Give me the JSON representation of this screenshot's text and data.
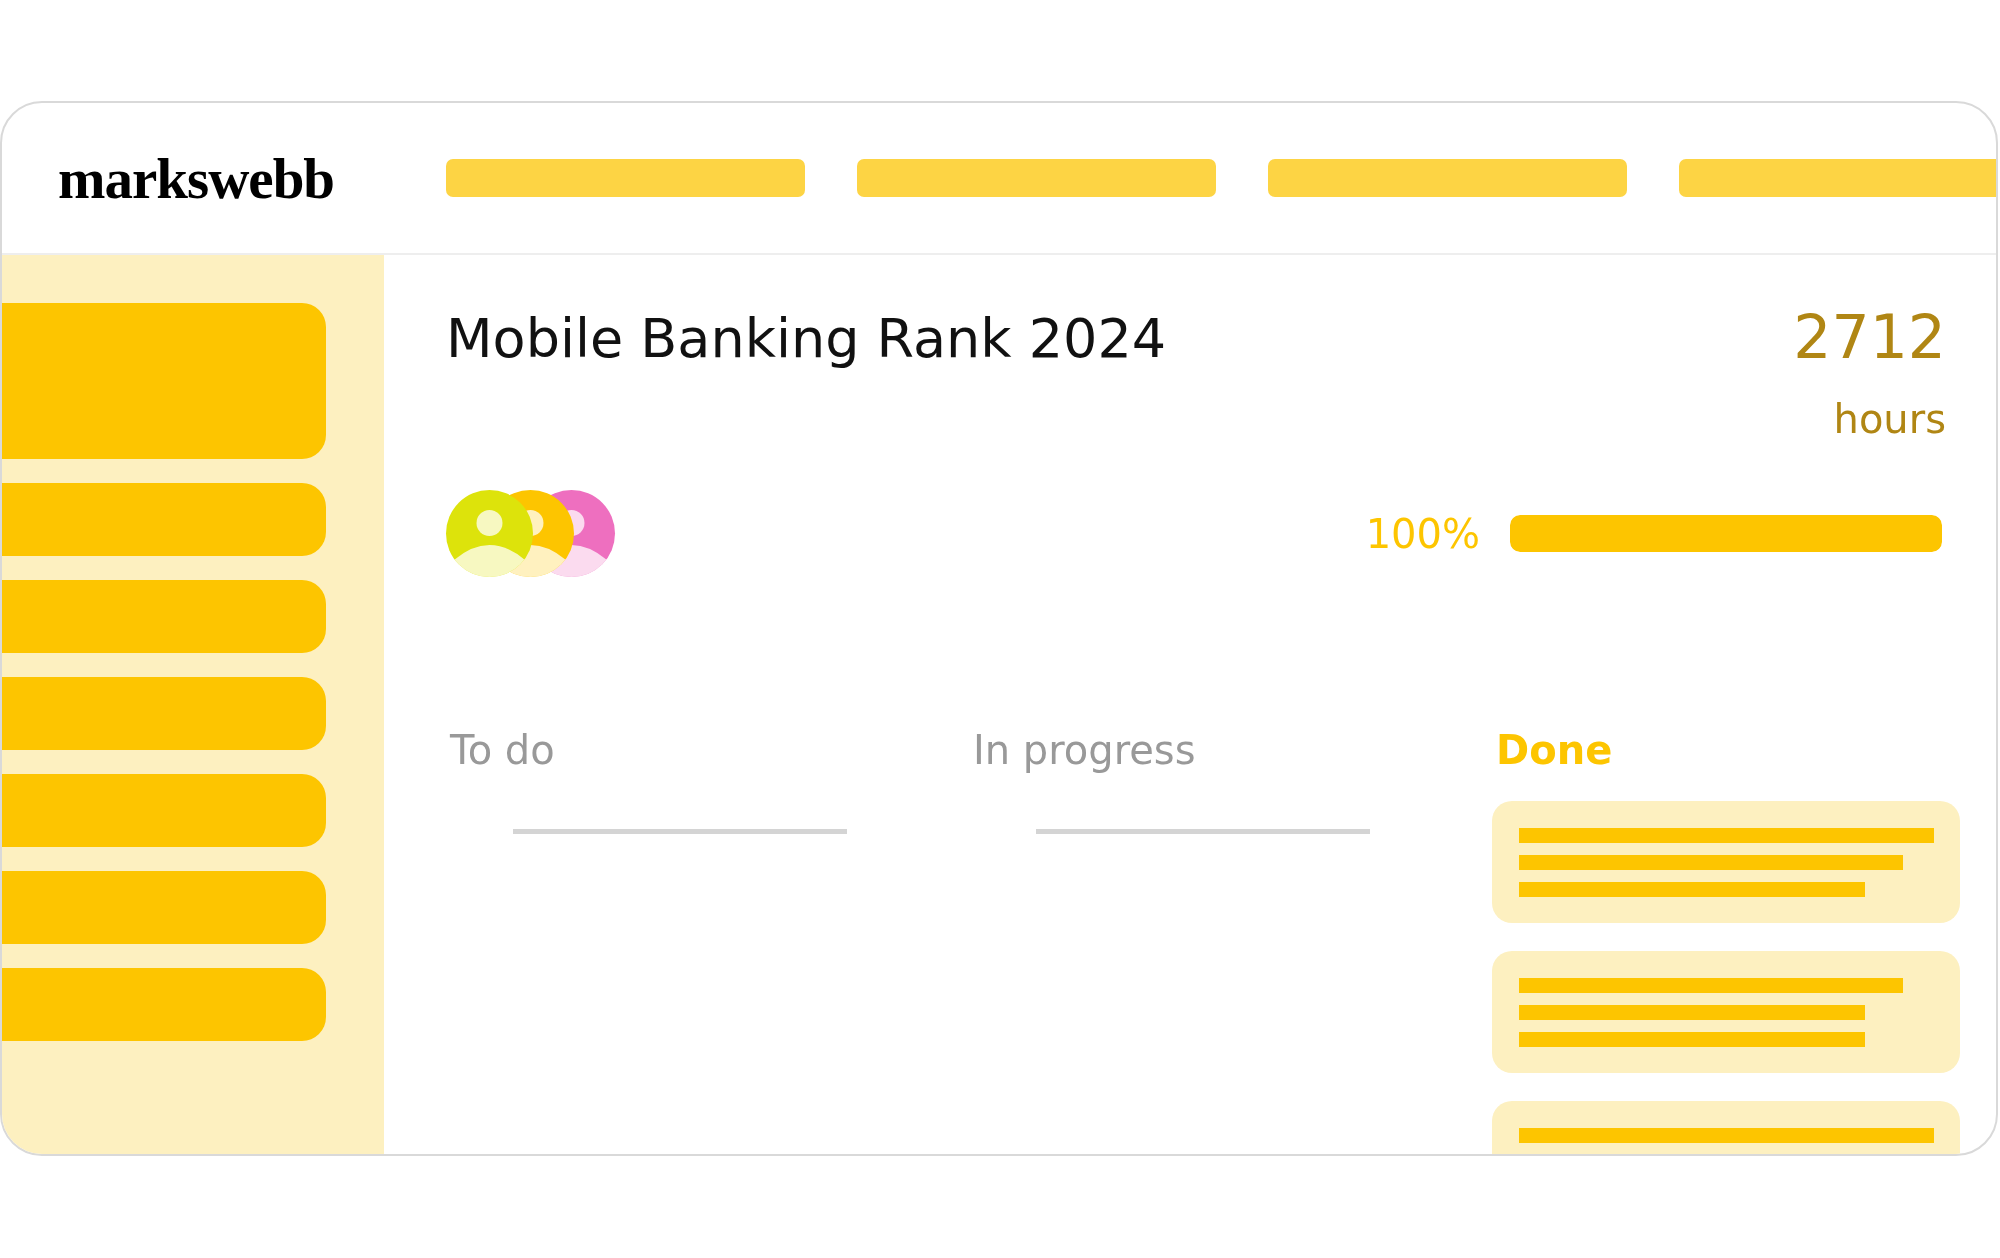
{
  "logo": "markswebb",
  "project": {
    "title": "Mobile Banking Rank 2024",
    "hours_value": "2712",
    "hours_unit": "hours",
    "avatars": [
      {
        "color": "#dde30b"
      },
      {
        "color": "#fdc500"
      },
      {
        "color": "#ee6fbf"
      }
    ],
    "progress": {
      "reading": "100%",
      "level": 1
    }
  },
  "columns": [
    {
      "label": "To do",
      "selected": false,
      "kind": "empty"
    },
    {
      "label": "In progress",
      "selected": false,
      "kind": "empty"
    },
    {
      "label": "Done",
      "selected": true,
      "kind": "cards"
    }
  ]
}
